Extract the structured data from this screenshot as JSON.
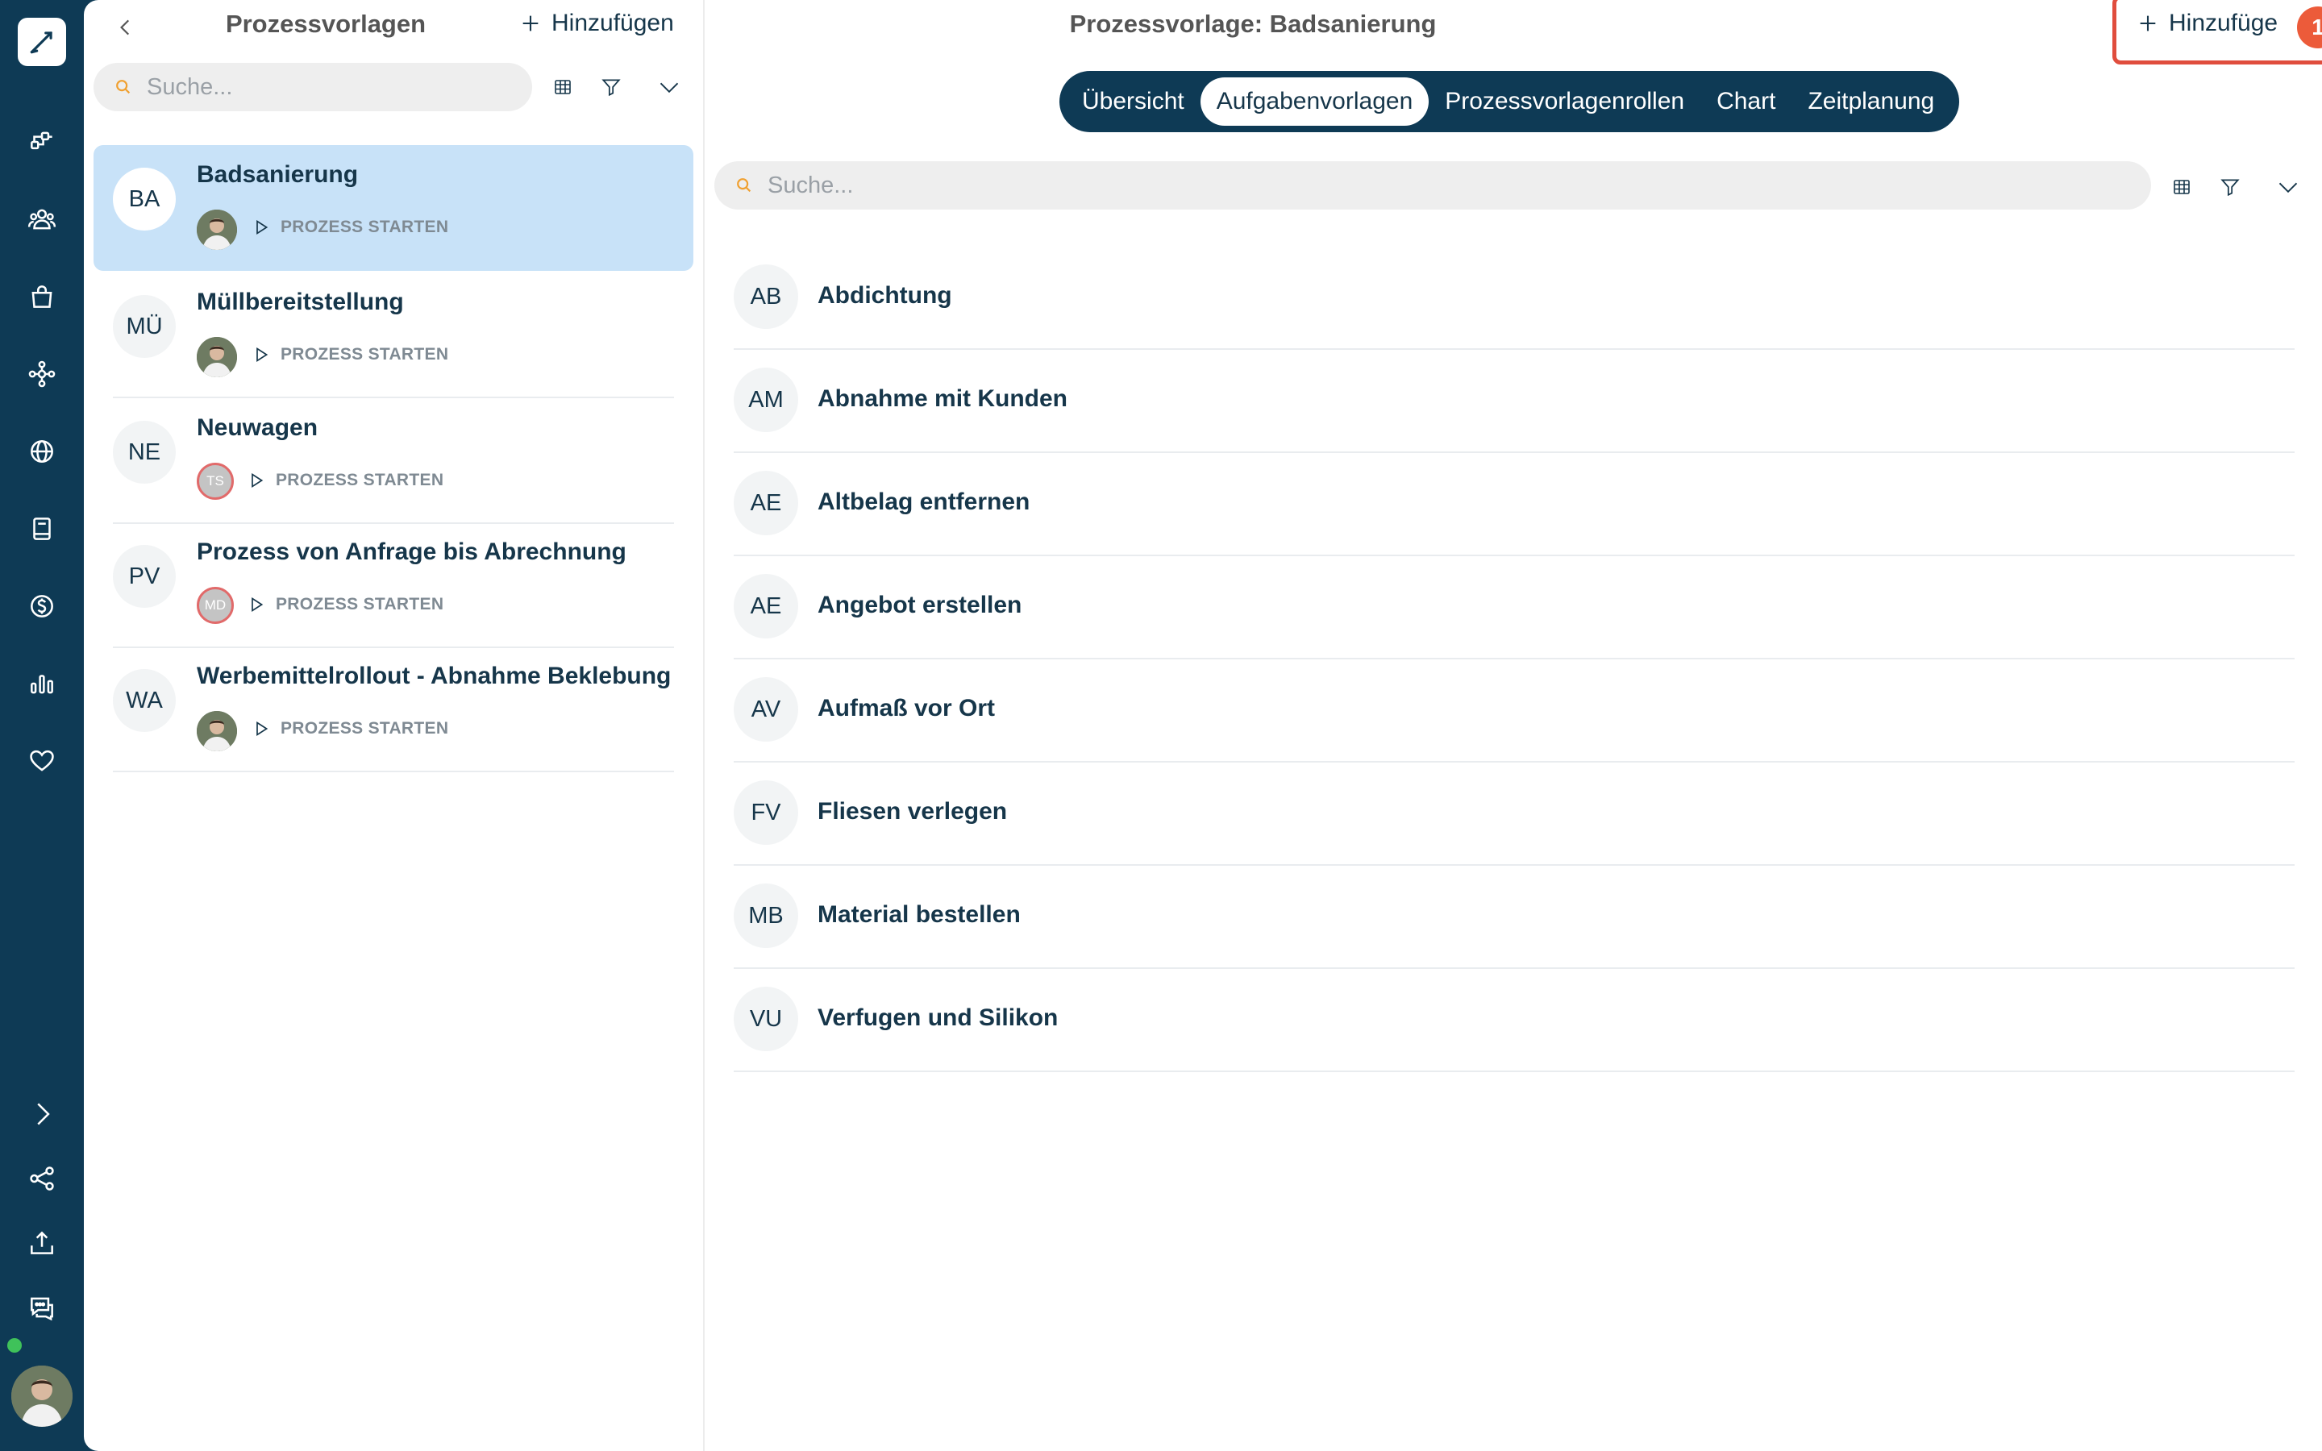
{
  "colors": {
    "accent": "#0e3a55",
    "selected_row": "#c8e2f8",
    "notification": "#ec5b3a",
    "online": "#3fc25a"
  },
  "rail": {
    "logo": "pen-icon",
    "nav_icons": [
      "process-flow-icon",
      "team-icon",
      "shopping-bag-icon",
      "network-icon",
      "globe-icon",
      "book-icon",
      "dollar-icon",
      "bar-chart-icon",
      "heart-icon"
    ],
    "bottom_icons": [
      "chevron-right-icon",
      "share-icon",
      "upload-icon",
      "chat-icon"
    ]
  },
  "list": {
    "title": "Prozessvorlagen",
    "add_label": "Hinzufügen",
    "search_placeholder": "Suche...",
    "items": [
      {
        "initials": "BA",
        "title": "Badsanierung",
        "owner": "photo",
        "action": "PROZESS STARTEN"
      },
      {
        "initials": "MÜ",
        "title": "Müllbereitstellung",
        "owner": "photo",
        "action": "PROZESS STARTEN"
      },
      {
        "initials": "NE",
        "title": "Neuwagen",
        "owner": "TS",
        "action": "PROZESS STARTEN"
      },
      {
        "initials": "PV",
        "title": "Prozess von Anfrage bis Abrechnung",
        "owner": "MD",
        "action": "PROZESS STARTEN"
      },
      {
        "initials": "WA",
        "title": "Werbemittelrollout - Abnahme Beklebung",
        "owner": "photo",
        "action": "PROZESS STARTEN"
      }
    ]
  },
  "detail": {
    "title": "Prozessvorlage: Badsanierung",
    "add_label": "Hinzufüge",
    "notification_count": "1",
    "tabs": [
      "Übersicht",
      "Aufgabenvorlagen",
      "Prozessvorlagenrollen",
      "Chart",
      "Zeitplanung"
    ],
    "active_tab": "Aufgabenvorlagen",
    "search_placeholder": "Suche...",
    "tasks": [
      {
        "initials": "AB",
        "label": "Abdichtung"
      },
      {
        "initials": "AM",
        "label": "Abnahme mit Kunden"
      },
      {
        "initials": "AE",
        "label": "Altbelag entfernen"
      },
      {
        "initials": "AE",
        "label": "Angebot erstellen"
      },
      {
        "initials": "AV",
        "label": "Aufmaß vor Ort"
      },
      {
        "initials": "FV",
        "label": "Fliesen verlegen"
      },
      {
        "initials": "MB",
        "label": "Material bestellen"
      },
      {
        "initials": "VU",
        "label": "Verfugen und Silikon"
      }
    ]
  }
}
